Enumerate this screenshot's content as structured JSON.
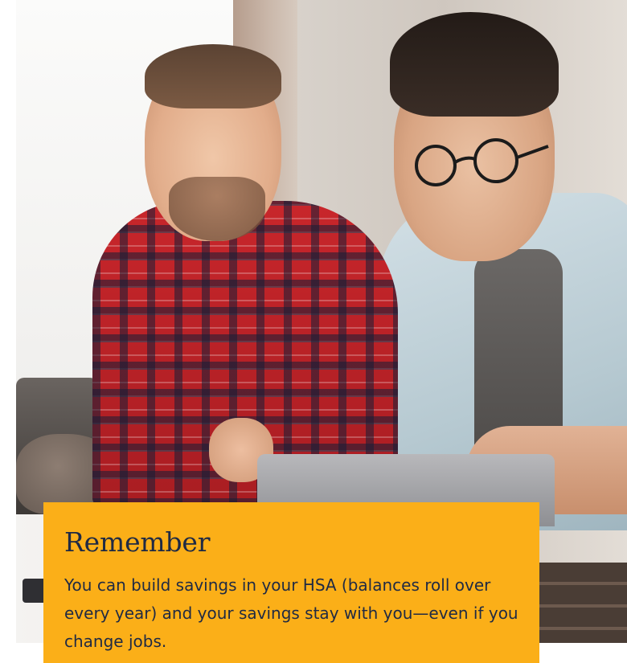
{
  "callout": {
    "title": "Remember",
    "body": "You can build savings in your HSA (balances roll over every year) and your savings stay with you—even if you change jobs."
  },
  "colors": {
    "accent": "#fbaf18",
    "text": "#1f2a44"
  }
}
